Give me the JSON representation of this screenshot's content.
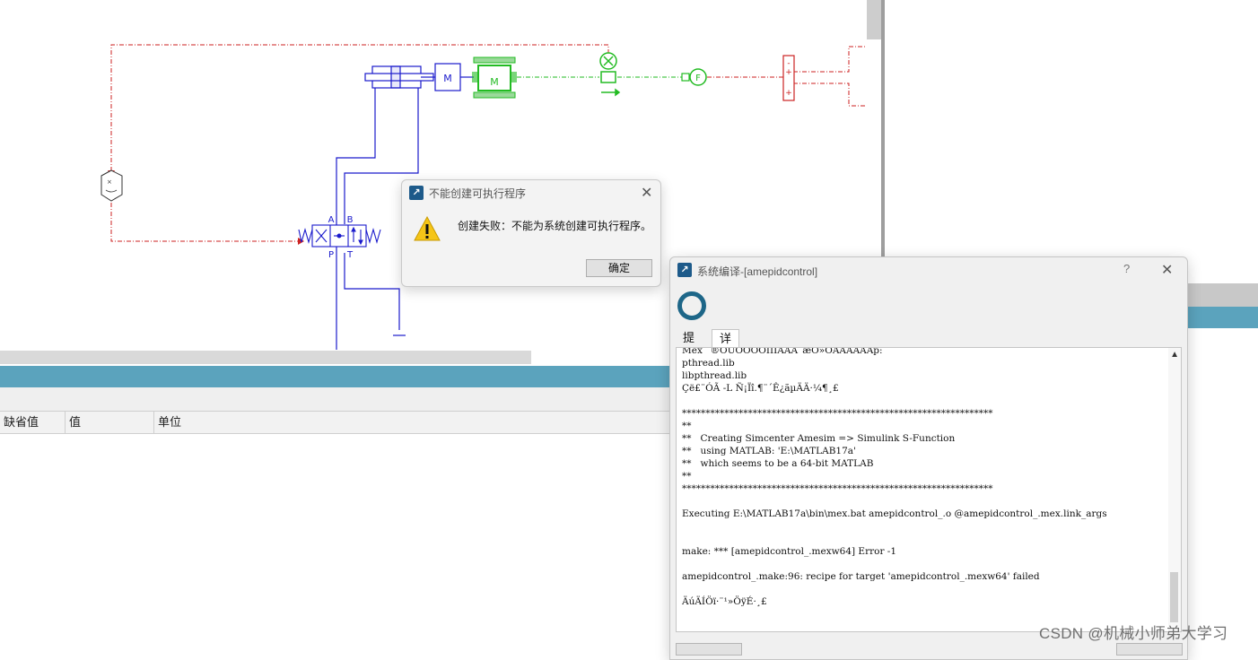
{
  "sketch": {
    "motor_label": "M",
    "valve_port_a": "A",
    "valve_port_b": "B",
    "valve_port_p": "P",
    "valve_port_t": "T",
    "sign_plus": "+",
    "sign_minus": "-",
    "colors": {
      "hydraulic": "#1a1acc",
      "mechanical": "#22bb22",
      "signal": "#cc2222"
    }
  },
  "parameter_table": {
    "columns": [
      "缺省值",
      "值",
      "单位"
    ]
  },
  "error_dialog": {
    "title": "不能创建可执行程序",
    "message": "创建失败：不能为系统创建可执行程序。",
    "ok_label": "确定",
    "close_glyph": "✕"
  },
  "compile_dialog": {
    "title": "系统编译-[amepidcontrol]",
    "help_glyph": "?",
    "close_glyph": "✕",
    "tabs": [
      {
        "label": "提示"
      },
      {
        "label": "详细"
      }
    ],
    "active_tab": "详细",
    "log_lines": [
      "Mex ´®ÓÚÖÖÕÖÎÎÎÄÄÄ´æÖ»ÖÄÃÄÅÃÅp:",
      "pthread.lib",
      "libpthread.lib",
      "Çë£¨ÓÃ -L Ñ¡Ïî.¶¨´Ê¿ãµÄÄ·¼¶¸£",
      "",
      "******************************************************************",
      "**",
      "**   Creating Simcenter Amesim => Simulink S-Function",
      "**   using MATLAB: 'E:\\MATLAB17a'",
      "**   which seems to be a 64-bit MATLAB",
      "**",
      "******************************************************************",
      "",
      "Executing E:\\MATLAB17a\\bin\\mex.bat amepidcontrol_.o @amepidcontrol_.mex.link_args",
      "",
      "",
      "make: *** [amepidcontrol_.mexw64] Error -1",
      "",
      "amepidcontrol_.make:96: recipe for target 'amepidcontrol_.mexw64' failed",
      "",
      "ÄúÄÍÖï·¨¹»ÖÿÉ·¸£"
    ]
  },
  "watermark": "CSDN @机械小师弟大学习"
}
